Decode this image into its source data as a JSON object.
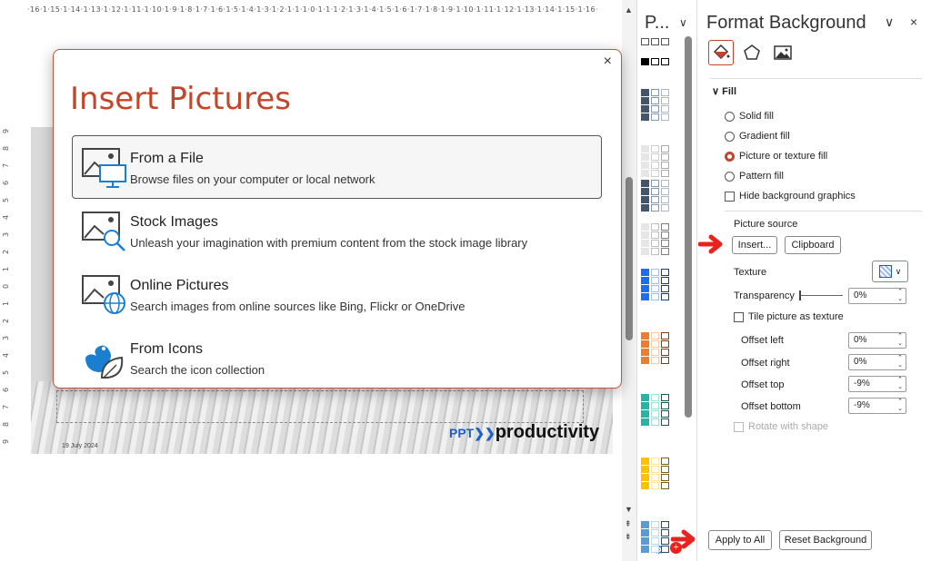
{
  "ruler": {
    "horizontal": "·16·1·15·1·14·1·13·1·12·1·11·1·10·1·9·1·8·1·7·1·6·1·5·1·4·1·3·1·2·1·1·1·0·1·1·1·2·1·3·1·4·1·5·1·6·1·7·1·8·1·9·1·10·1·11·1·12·1·13·1·14·1·15·1·16·",
    "vertical": [
      "9",
      "8",
      "7",
      "6",
      "5",
      "4",
      "3",
      "2",
      "1",
      "0",
      "1",
      "2",
      "3",
      "4",
      "5",
      "6",
      "7",
      "8",
      "9"
    ]
  },
  "slide": {
    "date": "19 July 2024",
    "logo_ppt": "PPT",
    "logo_text": "productivity"
  },
  "dialog": {
    "title": "Insert Pictures",
    "close": "×",
    "options": [
      {
        "title": "From a File",
        "desc": "Browse files on your computer or local network"
      },
      {
        "title": "Stock Images",
        "desc": "Unleash your imagination with premium content from the stock image library"
      },
      {
        "title": "Online Pictures",
        "desc": "Search images from online sources like Bing, Flickr or OneDrive"
      },
      {
        "title": "From Icons",
        "desc": "Search the icon collection"
      }
    ]
  },
  "palette": {
    "title": "P...",
    "chevron": "∨"
  },
  "pane": {
    "title": "Format Background",
    "fill_section": "Fill",
    "fill_options": {
      "solid": "Solid fill",
      "gradient": "Gradient fill",
      "picture": "Picture or texture fill",
      "pattern": "Pattern fill",
      "hide": "Hide background graphics"
    },
    "picture_source": "Picture source",
    "insert": "Insert...",
    "clipboard": "Clipboard",
    "texture": "Texture",
    "transparency": "Transparency",
    "transparency_value": "0%",
    "tile": "Tile picture as texture",
    "offset_left": "Offset left",
    "offset_left_value": "0%",
    "offset_right": "Offset right",
    "offset_right_value": "0%",
    "offset_top": "Offset top",
    "offset_top_value": "-9%",
    "offset_bottom": "Offset bottom",
    "offset_bottom_value": "-9%",
    "rotate": "Rotate with shape",
    "apply_all": "Apply to All",
    "reset": "Reset Background"
  },
  "colors": {
    "accent": "#c4452a",
    "arrow": "#e8231d",
    "logo_blue": "#1a5fd0"
  }
}
